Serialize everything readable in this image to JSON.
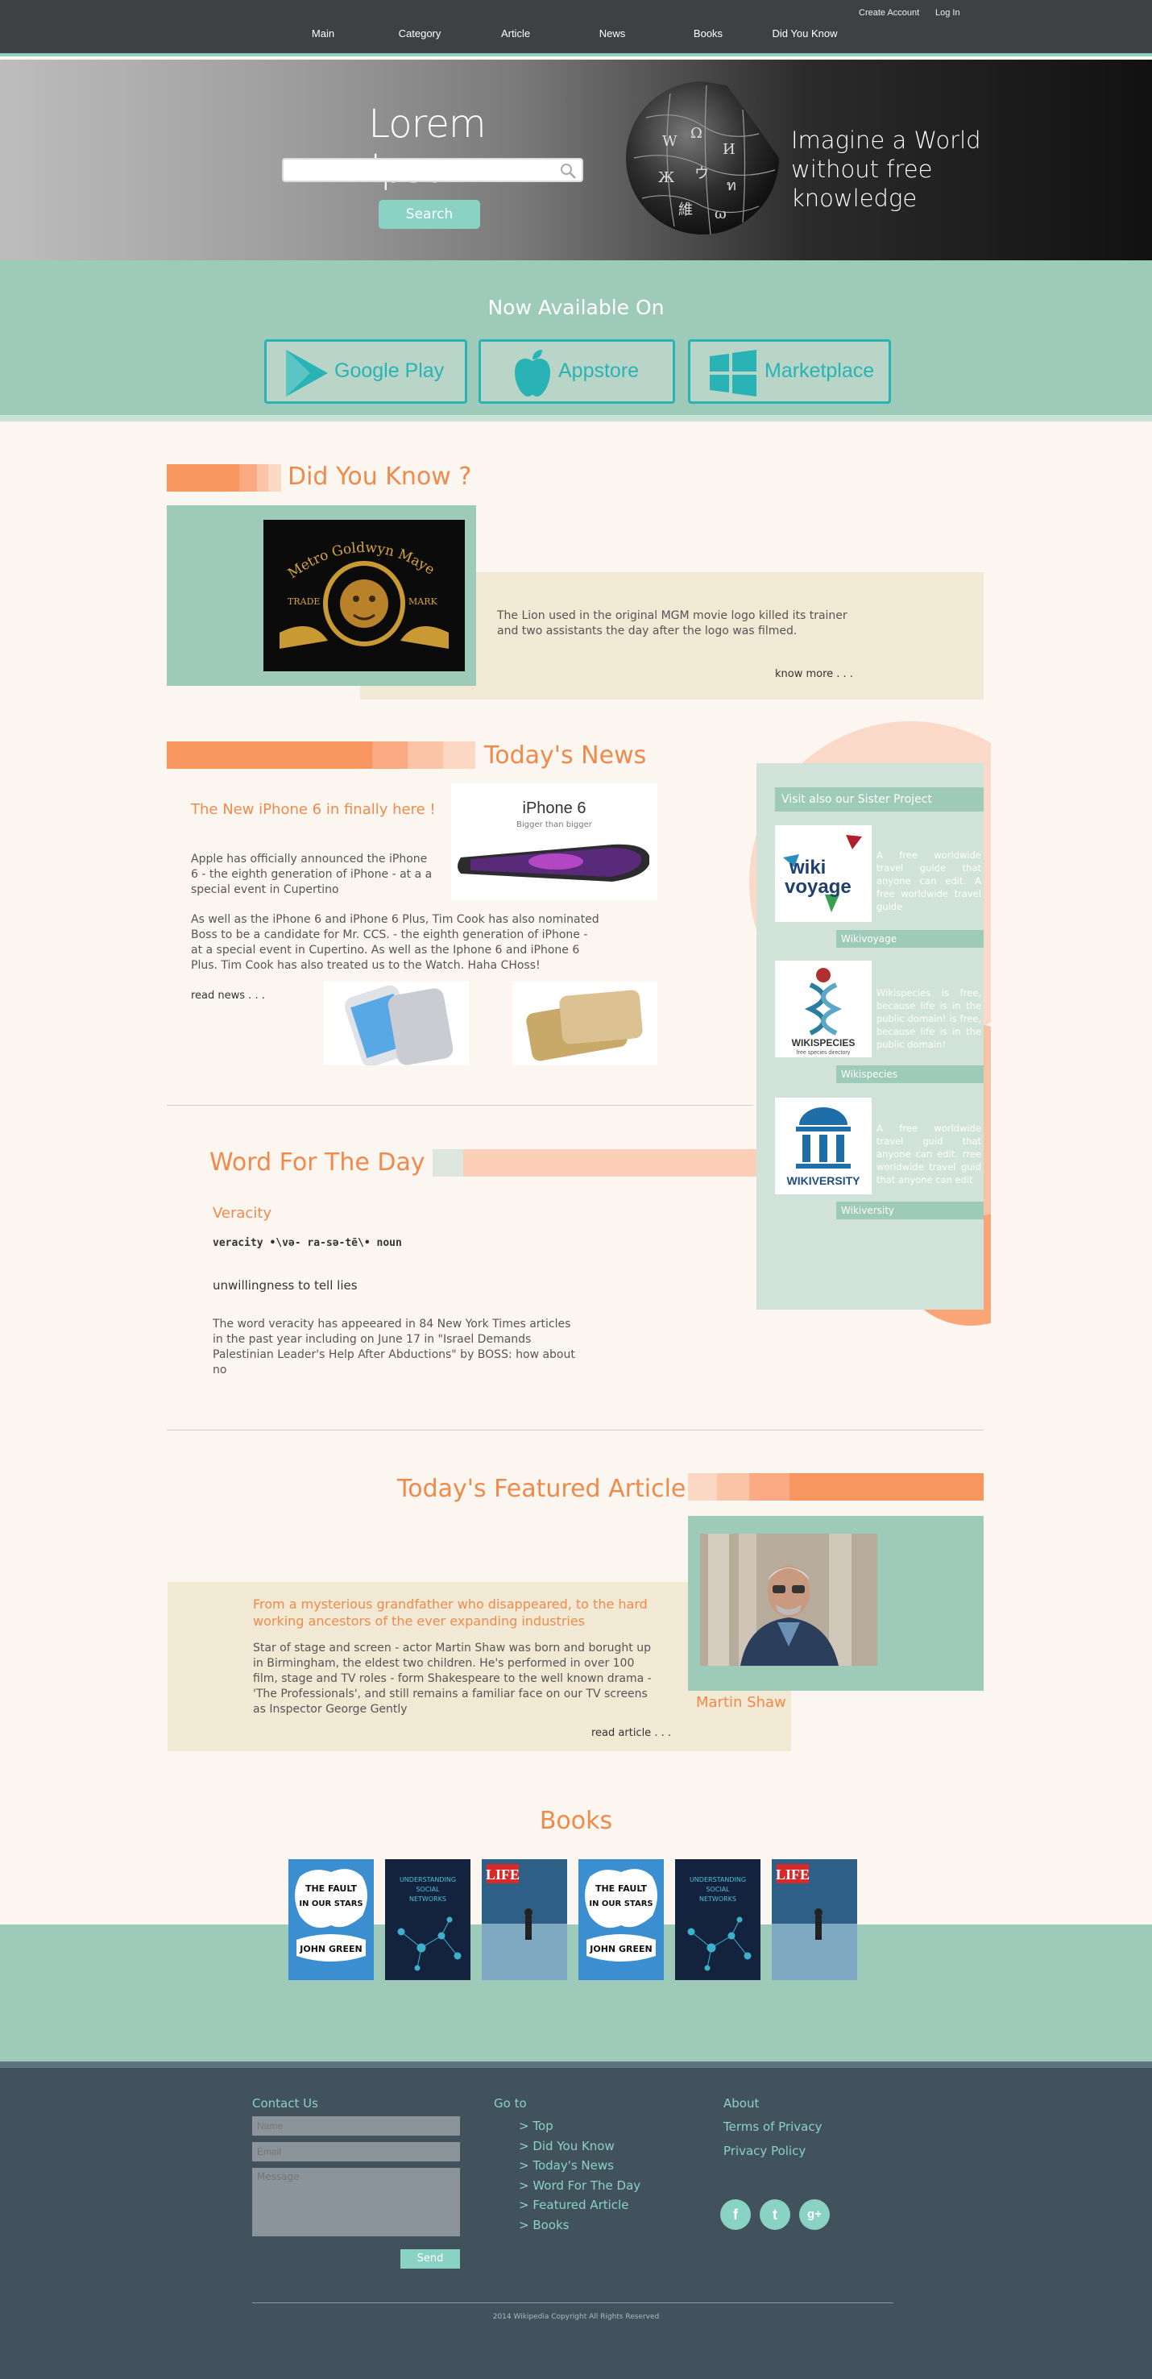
{
  "topbar": {
    "account": [
      "Create Account",
      "Log In"
    ],
    "nav": [
      "Main",
      "Category",
      "Article",
      "News",
      "Books",
      "Did You Know"
    ]
  },
  "hero": {
    "title": "Lorem Ipsum",
    "search_placeholder": "",
    "search_button": "Search",
    "slogan": [
      "Imagine a World",
      "without free",
      "knowledge"
    ]
  },
  "apps": {
    "heading": "Now Available On",
    "stores": [
      "Google Play",
      "Appstore",
      "Marketplace"
    ]
  },
  "did_you_know": {
    "title": "Did You Know ?",
    "image_text": [
      "Metro Goldwyn Mayer",
      "TRADE",
      "MARK"
    ],
    "text": "The Lion used in the original MGM movie logo killed its trainer and two assistants the day after the logo was filmed.",
    "more": "know more . . ."
  },
  "news": {
    "title": "Today's News",
    "headline": "The New iPhone 6 in finally here !",
    "p1": "Apple has officially announced the iPhone 6 - the eighth generation of iPhone - at a a special event in Cupertino",
    "p2": "As well as the iPhone 6 and iPhone 6 Plus, Tim Cook has also nominated Boss to be a candidate for Mr. CCS. - the eighth generation of iPhone - at a special event in Cupertino. As well as the Iphone 6 and iPhone 6 Plus. Tim Cook has also treated us to the Watch. Haha CHoss!",
    "more": "read news . . .",
    "ad_title": "iPhone 6",
    "ad_subtitle": "Bigger than bigger"
  },
  "sidebar": {
    "heading": "Visit also our Sister Project",
    "projects": [
      {
        "label": "Wikivoyage",
        "desc": "A free worldwide travel guide that anyone can edit. A free worldwide travel guide",
        "logo": [
          "wiki",
          "voyage"
        ]
      },
      {
        "label": "Wikispecies",
        "desc": "Wikispecies is free, because life is in the public domain! is free, because life is in the public domain!",
        "logo": [
          "WIKISPECIES",
          "free species directory"
        ]
      },
      {
        "label": "Wikiversity",
        "desc": "A free worldwide travel guid that anyone can edit. rree worldwide travel guid that anyone can edit",
        "logo": [
          "WIKIVERSITY"
        ]
      }
    ]
  },
  "word_of_day": {
    "title": "Word For The Day",
    "word": "Veracity",
    "pronunciation": "veracity •\\və- ra-sə-tē\\• noun",
    "definition": "unwillingness to tell lies",
    "body": "The word veracity has appeeared in 84 New York Times articles in the past year including on June 17 in \"Israel Demands Palestinian Leader's Help After Abductions\" by BOSS: how about no"
  },
  "featured": {
    "title": "Today's Featured Article",
    "lead": "From a mysterious grandfather who disappeared, to the hard working ancestors of the ever expanding industries",
    "body": "Star of stage and screen - actor Martin Shaw was born and borught up in Birmingham, the eldest two children. He's performed in over 100 film, stage and TV roles - form Shakespeare to the well known drama - 'The Professionals', and still remains a familiar face on our TV screens as Inspector George Gently",
    "more": "read article . . .",
    "name": "Martin Shaw"
  },
  "books": {
    "title": "Books",
    "items": [
      {
        "kind": "fault",
        "lines": [
          "THE FAULT",
          "IN OUR STARS",
          "JOHN GREEN"
        ]
      },
      {
        "kind": "networks",
        "lines": [
          "UNDERSTANDING",
          "SOCIAL",
          "NETWORKS"
        ]
      },
      {
        "kind": "life",
        "lines": [
          "LIFE"
        ]
      },
      {
        "kind": "fault",
        "lines": [
          "THE FAULT",
          "IN OUR STARS",
          "JOHN GREEN"
        ]
      },
      {
        "kind": "networks",
        "lines": [
          "UNDERSTANDING",
          "SOCIAL",
          "NETWORKS"
        ]
      },
      {
        "kind": "life",
        "lines": [
          "LIFE"
        ]
      }
    ]
  },
  "footer": {
    "contact": {
      "heading": "Contact Us",
      "name": "Name",
      "email": "Email",
      "message": "Message",
      "send": "Send"
    },
    "goto": {
      "heading": "Go to",
      "links": [
        "> Top",
        "> Did You Know",
        "> Today's News",
        "> Word For The Day",
        "> Featured Article",
        "> Books"
      ]
    },
    "about": {
      "links": [
        "About",
        "Terms of Privacy",
        "Privacy Policy"
      ]
    },
    "social": [
      "f",
      "t",
      "g+"
    ],
    "copyright": "2014 Wikipedia Copyright All Rights Reserved"
  },
  "colors": {
    "accent": "#f08a4b",
    "mint": "#9dcab9",
    "teal": "#2ab3b4",
    "cream": "#f2e9d5",
    "footer": "#42525c"
  }
}
